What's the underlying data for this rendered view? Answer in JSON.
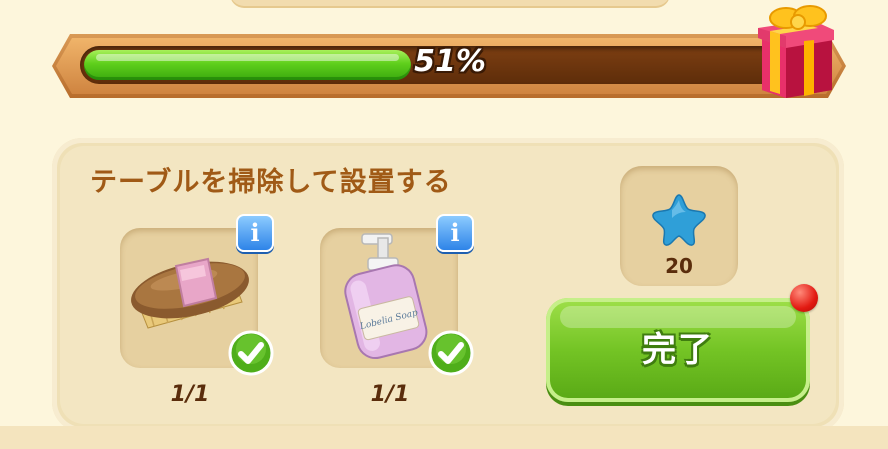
{
  "progress": {
    "percent_text": "51%",
    "fraction": 0.51
  },
  "task": {
    "title": "テーブルを掃除して設置する",
    "items": [
      {
        "name": "brush",
        "icon": "brush-icon",
        "count": "1/1",
        "done": true
      },
      {
        "name": "soap",
        "icon": "soap-bottle-icon",
        "count": "1/1",
        "done": true
      }
    ],
    "bottle_label": "Lobelia Soap"
  },
  "reward": {
    "icon": "blue-star-icon",
    "amount": "20"
  },
  "complete_button": {
    "label": "完了"
  },
  "colors": {
    "progress_green": "#5fcf1c",
    "button_green": "#74c425",
    "title_brown": "#a05a16",
    "info_blue": "#2e84e8",
    "star_blue": "#2f9fd8",
    "notification_red": "#e21a12"
  }
}
